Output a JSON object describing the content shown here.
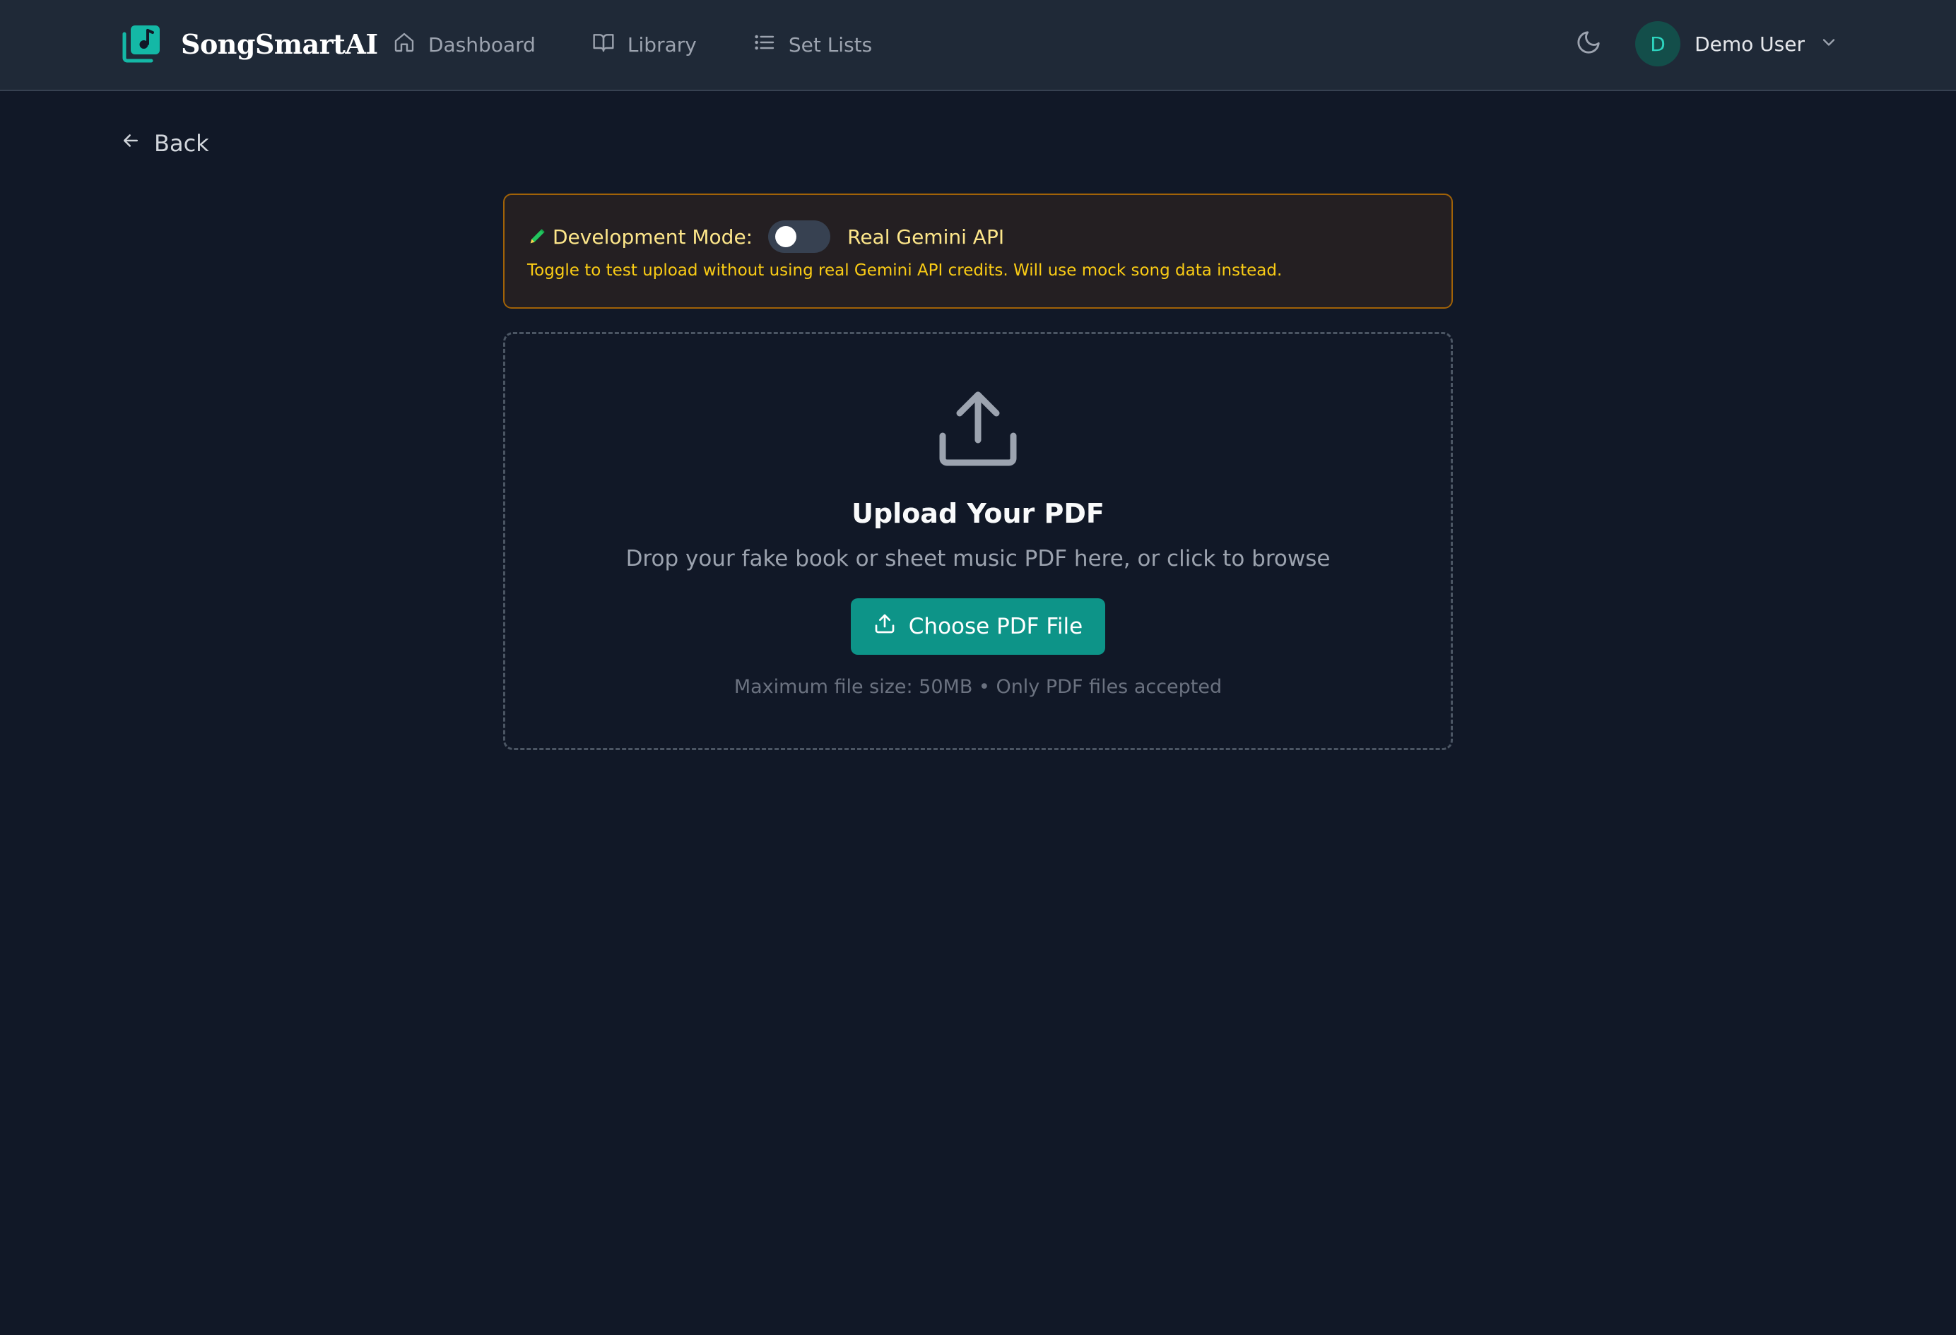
{
  "app": {
    "name": "SongSmartAI",
    "accent_color": "#14b8a6"
  },
  "nav": {
    "items": [
      {
        "label": "Dashboard",
        "icon": "home-icon"
      },
      {
        "label": "Library",
        "icon": "book-open-icon"
      },
      {
        "label": "Set Lists",
        "icon": "list-icon"
      }
    ]
  },
  "user": {
    "initial": "D",
    "name": "Demo User"
  },
  "back": {
    "label": "Back"
  },
  "dev_mode": {
    "label": "Development Mode:",
    "toggle_on": false,
    "mode_text": "Real Gemini API",
    "help_text": "Toggle to test upload without using real Gemini API credits. Will use mock song data instead."
  },
  "upload": {
    "title": "Upload Your PDF",
    "subtitle": "Drop your fake book or sheet music PDF here, or click to browse",
    "button_label": "Choose PDF File",
    "note": "Maximum file size: 50MB • Only PDF files accepted"
  }
}
